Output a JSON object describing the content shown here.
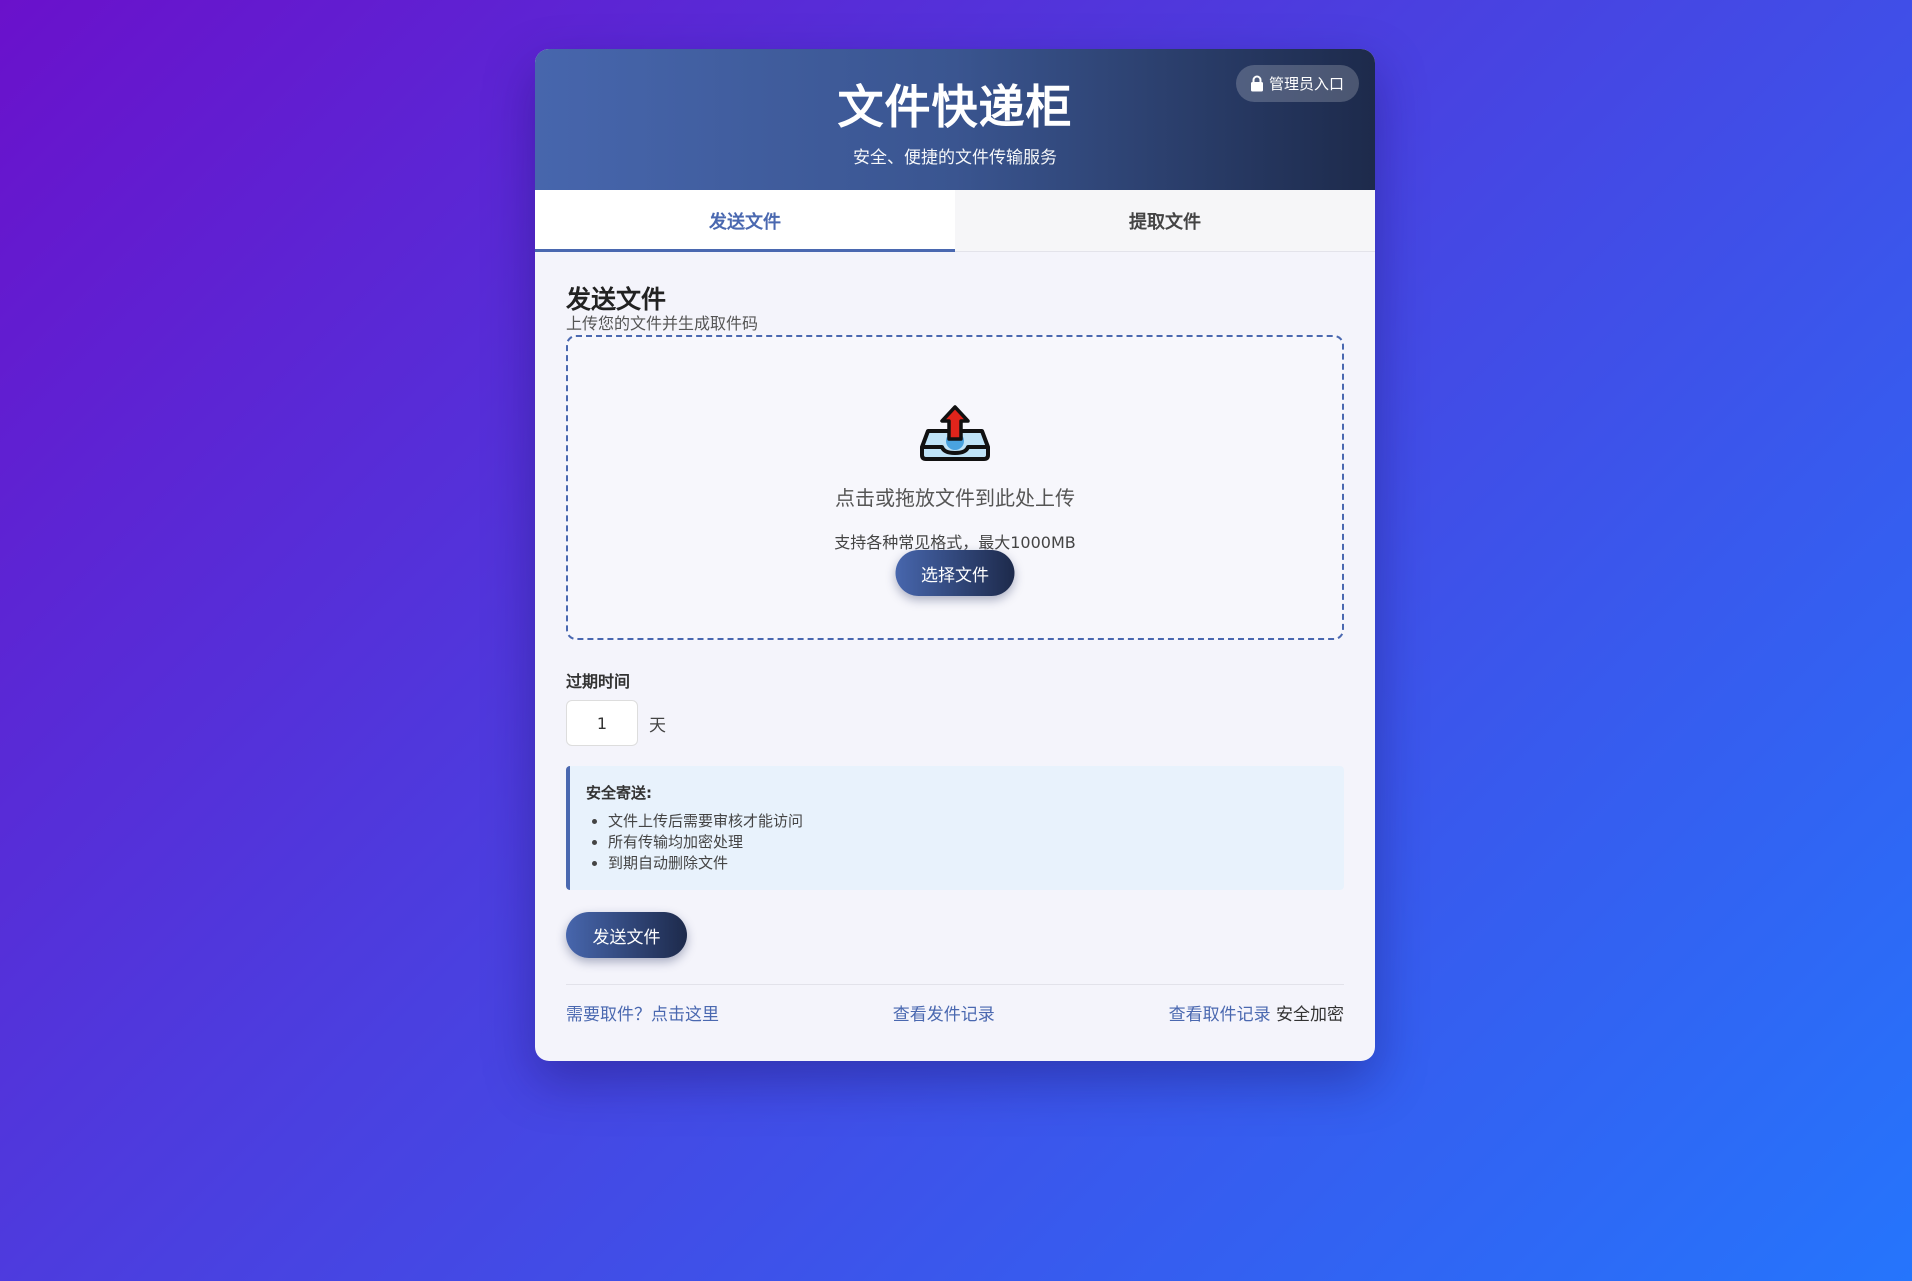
{
  "header": {
    "title": "文件快递柜",
    "subtitle": "安全、便捷的文件传输服务",
    "admin_label": "管理员入口",
    "admin_icon": "lock-icon"
  },
  "tabs": [
    {
      "label": "发送文件",
      "active": true
    },
    {
      "label": "提取文件",
      "active": false
    }
  ],
  "send": {
    "title": "发送文件",
    "subtitle": "上传您的文件并生成取件码",
    "dropzone": {
      "icon": "inbox-upload-icon",
      "text": "点击或拖放文件到此处上传",
      "hint": "支持各种常见格式，最大1000MB",
      "choose_label": "选择文件"
    },
    "expiry": {
      "label": "过期时间",
      "value": "1",
      "unit": "天"
    },
    "notice": {
      "title": "安全寄送:",
      "items": [
        "文件上传后需要审核才能访问",
        "所有传输均加密处理",
        "到期自动删除文件"
      ]
    },
    "submit_label": "发送文件"
  },
  "footer": {
    "pickup_link": "需要取件？点击这里",
    "send_records": "查看发件记录",
    "pickup_records": "查看取件记录",
    "secure_text": "安全加密"
  },
  "colors": {
    "accent": "#4a68b0",
    "header_dark": "#1d2a4b",
    "notice_bg": "#e8f2fc"
  }
}
